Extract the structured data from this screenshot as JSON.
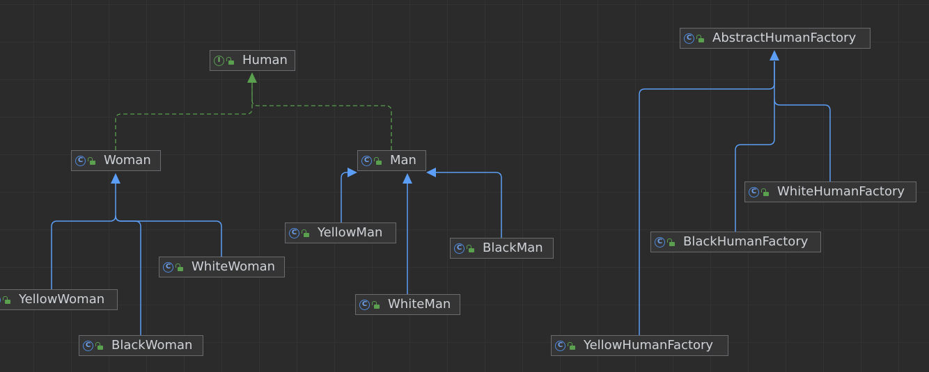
{
  "nodes": {
    "human": {
      "name": "Human",
      "kind": "I",
      "icon": "interface-icon"
    },
    "woman": {
      "name": "Woman",
      "kind": "C",
      "icon": "class-icon"
    },
    "man": {
      "name": "Man",
      "kind": "C",
      "icon": "class-icon"
    },
    "yellow_man": {
      "name": "YellowMan",
      "kind": "C",
      "icon": "class-icon"
    },
    "black_man": {
      "name": "BlackMan",
      "kind": "C",
      "icon": "class-icon"
    },
    "white_man": {
      "name": "WhiteMan",
      "kind": "C",
      "icon": "class-icon"
    },
    "white_woman": {
      "name": "WhiteWoman",
      "kind": "C",
      "icon": "class-icon"
    },
    "yellow_woman": {
      "name": "YellowWoman",
      "kind": "C",
      "icon": "class-icon"
    },
    "black_woman": {
      "name": "BlackWoman",
      "kind": "C",
      "icon": "class-icon"
    },
    "abstract_factory": {
      "name": "AbstractHumanFactory",
      "kind": "C",
      "icon": "class-icon"
    },
    "white_factory": {
      "name": "WhiteHumanFactory",
      "kind": "C",
      "icon": "class-icon"
    },
    "black_factory": {
      "name": "BlackHumanFactory",
      "kind": "C",
      "icon": "class-icon"
    },
    "yellow_factory": {
      "name": "YellowHumanFactory",
      "kind": "C",
      "icon": "class-icon"
    }
  },
  "relations": [
    {
      "from": "Woman",
      "to": "Human",
      "type": "implements"
    },
    {
      "from": "Man",
      "to": "Human",
      "type": "implements"
    },
    {
      "from": "YellowMan",
      "to": "Man",
      "type": "extends"
    },
    {
      "from": "WhiteMan",
      "to": "Man",
      "type": "extends"
    },
    {
      "from": "BlackMan",
      "to": "Man",
      "type": "extends"
    },
    {
      "from": "YellowWoman",
      "to": "Woman",
      "type": "extends"
    },
    {
      "from": "BlackWoman",
      "to": "Woman",
      "type": "extends"
    },
    {
      "from": "WhiteWoman",
      "to": "Woman",
      "type": "extends"
    },
    {
      "from": "YellowHumanFactory",
      "to": "AbstractHumanFactory",
      "type": "extends"
    },
    {
      "from": "BlackHumanFactory",
      "to": "AbstractHumanFactory",
      "type": "extends"
    },
    {
      "from": "WhiteHumanFactory",
      "to": "AbstractHumanFactory",
      "type": "extends"
    }
  ],
  "colors": {
    "background": "#2b2b2b",
    "extends_edge": "#5c9ef5",
    "implements_edge": "#5aa04f",
    "node_fill": "#353536",
    "node_border": "#6a6c6f",
    "text": "#cfd2d6"
  }
}
